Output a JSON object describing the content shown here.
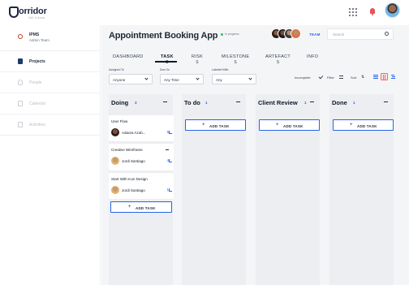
{
  "brand": {
    "name": "orridor",
    "tagline": "Get it done"
  },
  "sidebar": {
    "project": {
      "name": "IPMS",
      "team": "Admin Team"
    },
    "items": [
      {
        "label": "Projects",
        "state": "active",
        "icon": "projects-icon"
      },
      {
        "label": "People",
        "state": "muted",
        "icon": "people-icon"
      },
      {
        "label": "Calendar",
        "state": "muted",
        "icon": "calendar-icon"
      },
      {
        "label": "Activities",
        "state": "muted",
        "icon": "activities-icon"
      }
    ]
  },
  "header": {
    "title": "Appointment Booking App",
    "status": "In progress",
    "status_color": "#22c55e",
    "team_label": "TEAM",
    "search_placeholder": "Search"
  },
  "tabs": [
    {
      "label": "DASHBOARD",
      "sub": ""
    },
    {
      "label": "TASK",
      "sub": "S",
      "active": true
    },
    {
      "label": "RISK",
      "sub": "S"
    },
    {
      "label": "MILESTONE",
      "sub": "S"
    },
    {
      "label": "ARTEFACT",
      "sub": "S"
    },
    {
      "label": "INFO",
      "sub": ""
    }
  ],
  "filters": {
    "assigned_to": {
      "label": "Assigned To",
      "value": "Anyone"
    },
    "due_on": {
      "label": "Due On",
      "value": "Any Time"
    },
    "labeled_with": {
      "label": "Labeled With",
      "value": "Any"
    },
    "incomplete": "Incomplete",
    "filter": "Filter",
    "sort": "Sort"
  },
  "board": {
    "add_task": "ADD TASK",
    "columns": [
      {
        "title": "Doing",
        "count": "3"
      },
      {
        "title": "To do",
        "count": "1"
      },
      {
        "title": "Client Review",
        "count": "1"
      },
      {
        "title": "Done",
        "count": "1"
      }
    ],
    "cards": [
      {
        "title": "User Flow",
        "assignee": "Adaora Azub...",
        "subtasks": "5"
      },
      {
        "title": "Creative Wireframe",
        "assignee": "Jordi Santiago",
        "subtasks": "4"
      },
      {
        "title": "Start With Icon Design",
        "assignee": "Jordi Santiago",
        "subtasks": "1"
      }
    ]
  },
  "colors": {
    "accent": "#2563eb",
    "navy": "#1c2541",
    "alert": "#e8525b"
  }
}
